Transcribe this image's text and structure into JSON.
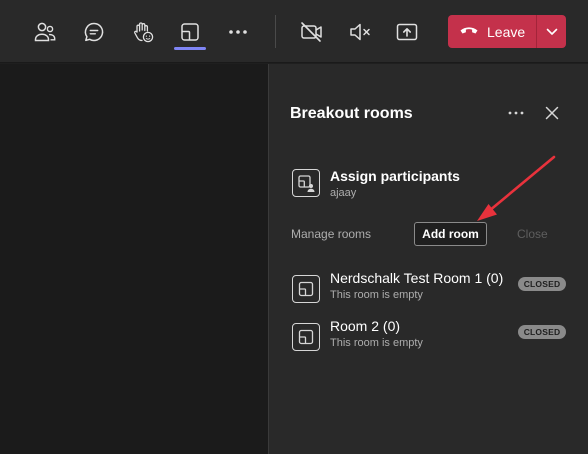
{
  "toolbar": {
    "icons": [
      "people-icon",
      "chat-icon",
      "raise-hand-icon",
      "breakout-rooms-icon",
      "more-icon",
      "camera-off-icon",
      "mic-muted-icon",
      "share-screen-icon"
    ],
    "active_icon": "breakout-rooms-icon",
    "leave_label": "Leave",
    "leave_color": "#c4314b",
    "accent_color": "#7f85f5"
  },
  "panel": {
    "title": "Breakout rooms",
    "assign": {
      "title": "Assign participants",
      "subtitle": "ajaay"
    },
    "manage_label": "Manage rooms",
    "add_room_label": "Add room",
    "close_label": "Close",
    "rooms": [
      {
        "name": "Nerdschalk Test Room 1 (0)",
        "status_text": "This room is empty",
        "badge": "CLOSED"
      },
      {
        "name": "Room 2 (0)",
        "status_text": "This room is empty",
        "badge": "CLOSED"
      }
    ]
  },
  "annotation": {
    "arrow_color": "#e8323c"
  }
}
